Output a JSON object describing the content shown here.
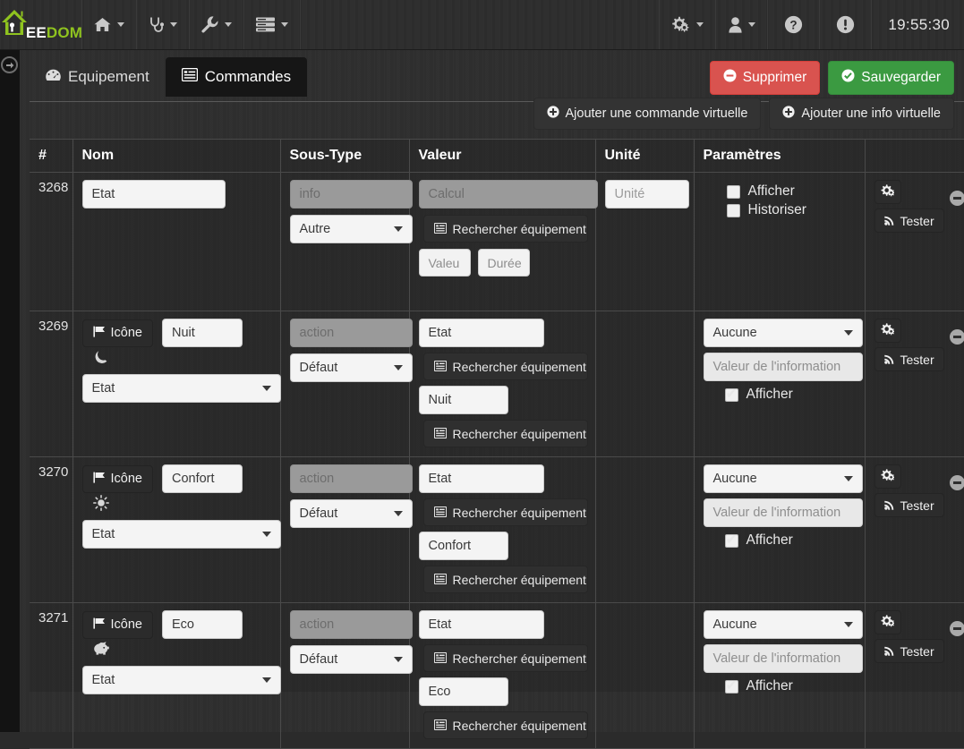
{
  "brand": {
    "text_white": "J",
    "text_rest": "EEDOM",
    "white_part": "EE",
    "green_part": "DOM"
  },
  "topbar": {
    "items": [
      {
        "name": "home-menu",
        "icon": "home-icon",
        "caret": true
      },
      {
        "name": "health-menu",
        "icon": "stethoscope-icon",
        "caret": true
      },
      {
        "name": "tools-menu",
        "icon": "wrench-icon",
        "caret": true
      },
      {
        "name": "plugins-menu",
        "icon": "server-icon",
        "caret": true
      }
    ],
    "right_items": [
      {
        "name": "settings-menu",
        "icon": "cogs-icon",
        "caret": true
      },
      {
        "name": "user-menu",
        "icon": "user-icon",
        "caret": true
      },
      {
        "name": "help-button",
        "icon": "question-circle-icon",
        "caret": false
      },
      {
        "name": "alerts-button",
        "icon": "exclamation-circle-icon",
        "caret": false
      }
    ],
    "clock": "19:55:30"
  },
  "rail": {
    "toggle_icon": "arrow-circle-right-icon"
  },
  "tabs": [
    {
      "label": "Equipement",
      "icon": "dashboard-icon",
      "active": false
    },
    {
      "label": "Commandes",
      "icon": "list-alt-icon",
      "active": true
    }
  ],
  "toolbar": {
    "delete_label": "Supprimer",
    "save_label": "Sauvegarder",
    "add_command_label": "Ajouter une commande virtuelle",
    "add_info_label": "Ajouter une info virtuelle",
    "delete_color": "#d9534f",
    "save_color": "#3b9a41"
  },
  "table": {
    "headers": [
      "#",
      "Nom",
      "Sous-Type",
      "Valeur",
      "Unité",
      "Paramètres",
      ""
    ],
    "common": {
      "search_label": "Rechercher équipement",
      "icon_button_label": "Icône",
      "test_label": "Tester",
      "config_icon": "cogs-icon",
      "remove_icon": "minus-circle-icon",
      "afficher_label": "Afficher",
      "historiser_label": "Historiser",
      "info_value_placeholder": "Valeur de l'information"
    },
    "rows": [
      {
        "id": "3268",
        "name_value": "Etat",
        "has_icon_button": false,
        "icon_glyph": "",
        "type_select": "",
        "subtype_placeholder": "info",
        "subtype_select": "Autre",
        "value_placeholder": "Calcul",
        "value_disabled": true,
        "value_search": true,
        "mini_buttons": [
          "Valeu",
          "Durée"
        ],
        "second_value": null,
        "second_search": false,
        "unit_placeholder": "Unité",
        "params_kind": "checkboxes",
        "afficher_checked": false,
        "historiser_checked": false
      },
      {
        "id": "3269",
        "name_value": "Nuit",
        "has_icon_button": true,
        "icon_glyph": "moon-icon",
        "type_select": "Etat",
        "subtype_placeholder": "action",
        "subtype_select": "Défaut",
        "value_first": "Etat",
        "value_search": true,
        "second_value": "Nuit",
        "second_search": true,
        "unit_placeholder": "",
        "params_kind": "info-select",
        "info_select": "Aucune",
        "afficher_label": "Afficher",
        "afficher_checked": true
      },
      {
        "id": "3270",
        "name_value": "Confort",
        "has_icon_button": true,
        "icon_glyph": "sun-icon",
        "type_select": "Etat",
        "subtype_placeholder": "action",
        "subtype_select": "Défaut",
        "value_first": "Etat",
        "value_search": true,
        "second_value": "Confort",
        "second_search": true,
        "unit_placeholder": "",
        "params_kind": "info-select",
        "info_select": "Aucune",
        "afficher_label": "Afficher",
        "afficher_checked": true
      },
      {
        "id": "3271",
        "name_value": "Eco",
        "has_icon_button": true,
        "icon_glyph": "piggy-bank-icon",
        "type_select": "Etat",
        "subtype_placeholder": "action",
        "subtype_select": "Défaut",
        "value_first": "Etat",
        "value_search": true,
        "second_value": "Eco",
        "second_search": true,
        "unit_placeholder": "",
        "params_kind": "info-select",
        "info_select": "Aucune",
        "afficher_label": "Afficher",
        "afficher_checked": true
      }
    ]
  }
}
